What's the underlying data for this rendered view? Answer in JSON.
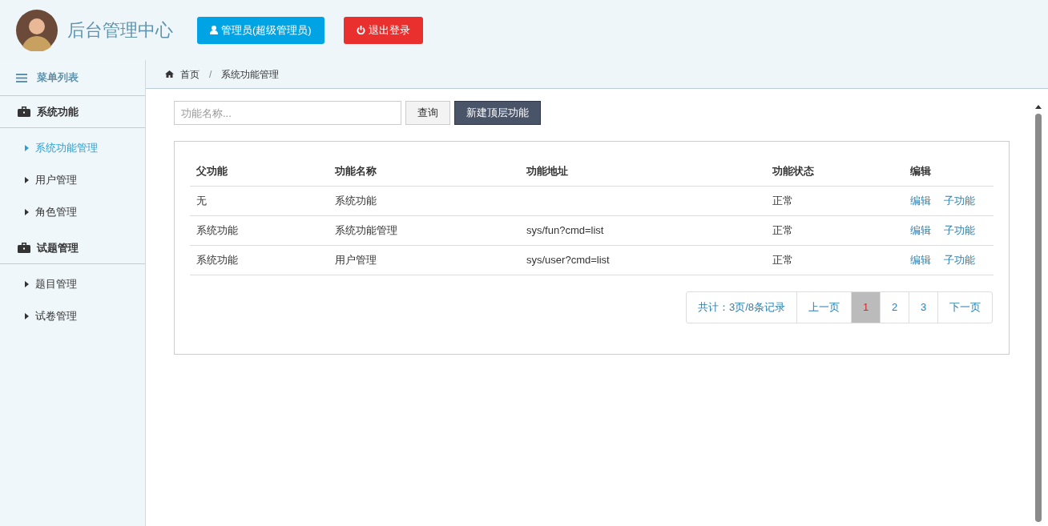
{
  "header": {
    "title": "后台管理中心",
    "user_button": "管理员(超级管理员)",
    "logout_button": "退出登录"
  },
  "sidebar": {
    "title": "菜单列表",
    "groups": [
      {
        "label": "系统功能",
        "items": [
          {
            "label": "系统功能管理",
            "selected": true
          },
          {
            "label": "用户管理",
            "selected": false
          },
          {
            "label": "角色管理",
            "selected": false
          }
        ]
      },
      {
        "label": "试题管理",
        "items": [
          {
            "label": "题目管理",
            "selected": false
          },
          {
            "label": "试卷管理",
            "selected": false
          }
        ]
      }
    ]
  },
  "breadcrumb": [
    "首页",
    "/",
    "系统功能管理"
  ],
  "search": {
    "placeholder": "功能名称...",
    "query_button": "查询",
    "new_button": "新建顶层功能"
  },
  "table": {
    "columns": [
      "父功能",
      "功能名称",
      "功能地址",
      "功能状态",
      "编辑"
    ],
    "rows": [
      {
        "parent": "无",
        "name": "系统功能",
        "status": "正常",
        "actions": [
          "编辑",
          "子功能"
        ]
      },
      {
        "parent": "系统功能",
        "name": "系统功能管理",
        "url": "sys/fun?cmd=list",
        "status": "正常",
        "actions": [
          "编辑",
          "子功能"
        ]
      },
      {
        "parent": "系统功能",
        "name": "用户管理",
        "url": "sys/user?cmd=list",
        "status": "正常",
        "actions": [
          "编辑",
          "子功能"
        ]
      }
    ]
  },
  "pagination": {
    "summary": "共计：3页/8条记录",
    "prev": "上一页",
    "pages": [
      {
        "label": "1",
        "selected": true
      },
      {
        "label": "2",
        "selected": false
      },
      {
        "label": "3",
        "selected": false
      }
    ],
    "next": "下一页"
  }
}
